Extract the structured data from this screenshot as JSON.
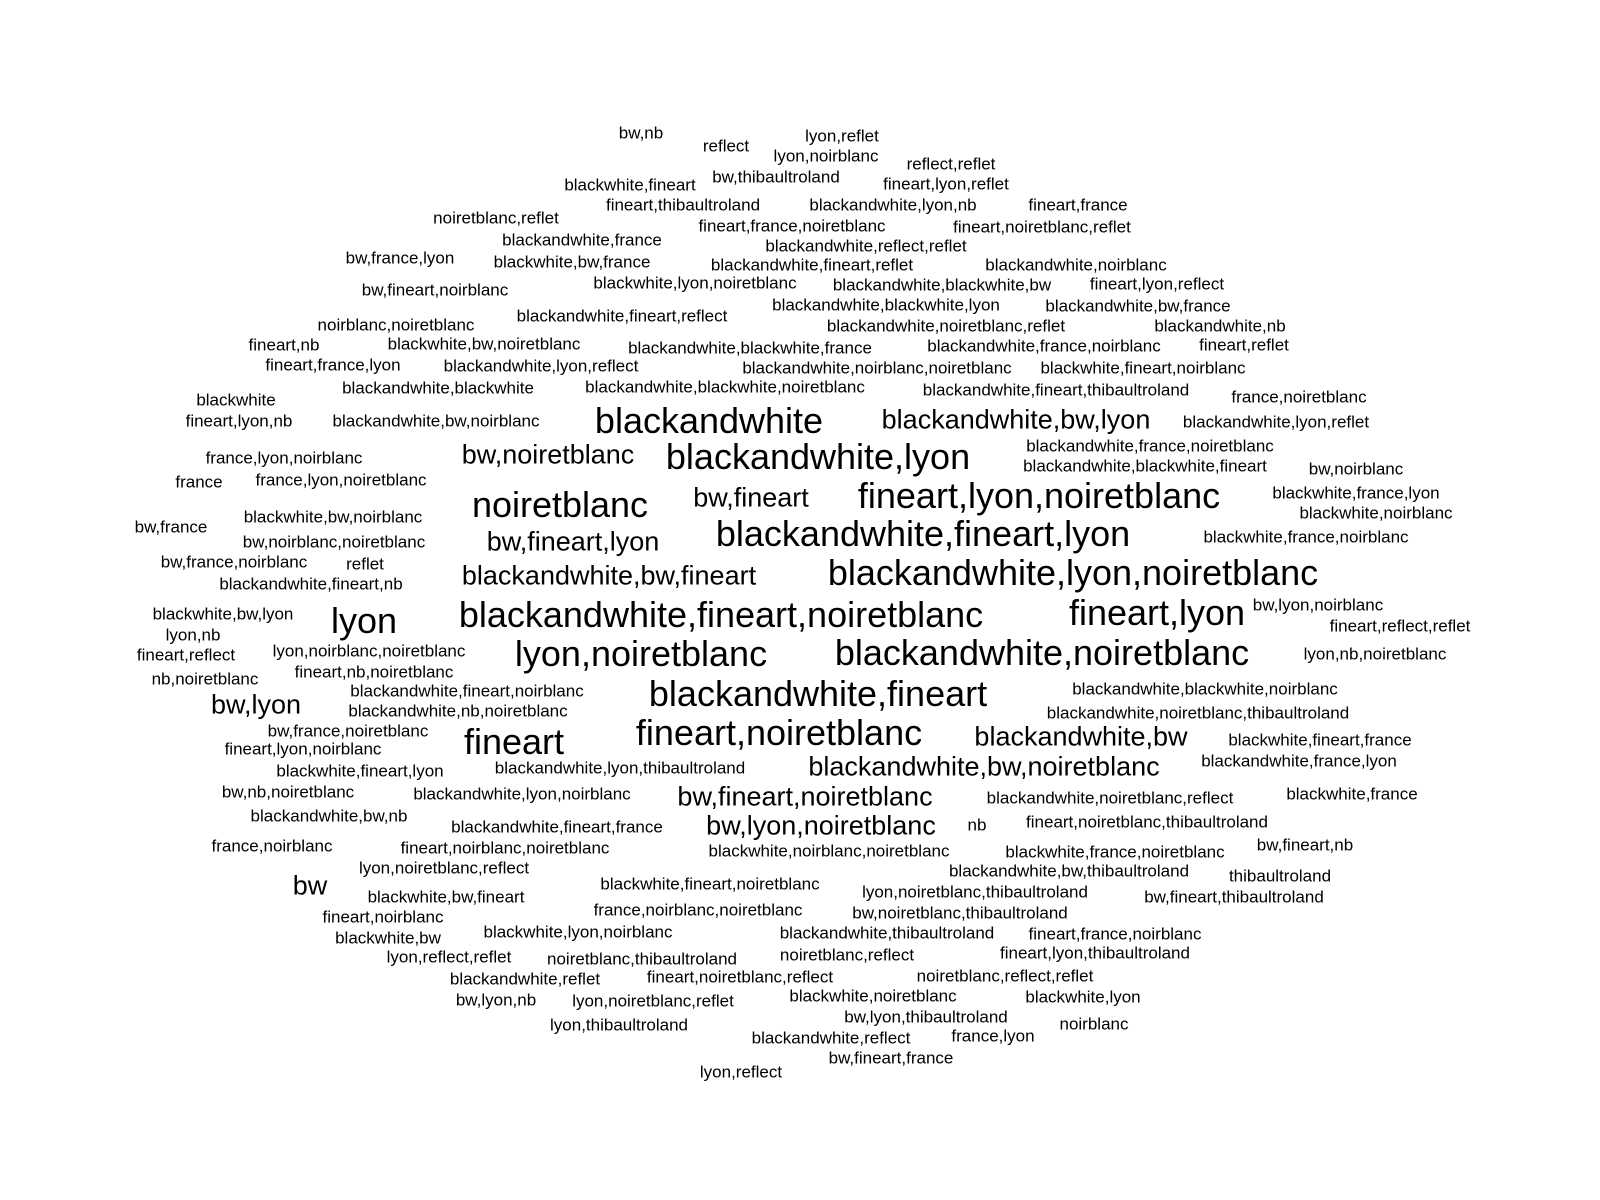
{
  "colors": {
    "background": "#ffffff",
    "text": "#000000"
  },
  "words": [
    "bw,nb",
    "reflect",
    "lyon,reflet",
    "lyon,noirblanc",
    "reflect,reflet",
    "bw,thibaultroland",
    "blackwhite,fineart",
    "fineart,lyon,reflet",
    "fineart,thibaultroland",
    "blackandwhite,lyon,nb",
    "fineart,france",
    "noiretblanc,reflet",
    "fineart,france,noiretblanc",
    "fineart,noiretblanc,reflet",
    "blackandwhite,france",
    "blackandwhite,reflect,reflet",
    "bw,france,lyon",
    "blackwhite,bw,france",
    "blackandwhite,fineart,reflet",
    "blackandwhite,noirblanc",
    "blackwhite,lyon,noiretblanc",
    "blackandwhite,blackwhite,bw",
    "fineart,lyon,reflect",
    "bw,fineart,noirblanc",
    "blackandwhite,blackwhite,lyon",
    "blackandwhite,bw,france",
    "blackandwhite,fineart,reflect",
    "noirblanc,noiretblanc",
    "blackandwhite,noiretblanc,reflet",
    "blackandwhite,nb",
    "fineart,nb",
    "blackwhite,bw,noiretblanc",
    "blackandwhite,blackwhite,france",
    "blackandwhite,france,noirblanc",
    "fineart,reflet",
    "fineart,france,lyon",
    "blackandwhite,lyon,reflect",
    "blackandwhite,noirblanc,noiretblanc",
    "blackwhite,fineart,noirblanc",
    "blackandwhite,blackwhite",
    "blackandwhite,blackwhite,noiretblanc",
    "blackandwhite,fineart,thibaultroland",
    "blackwhite",
    "france,noiretblanc",
    "fineart,lyon,nb",
    "blackandwhite,bw,noirblanc",
    "blackandwhite",
    "blackandwhite,bw,lyon",
    "blackandwhite,lyon,reflet",
    "france,lyon,noirblanc",
    "bw,noiretblanc",
    "blackandwhite,lyon",
    "blackandwhite,france,noiretblanc",
    "blackandwhite,blackwhite,fineart",
    "france",
    "france,lyon,noiretblanc",
    "bw,noirblanc",
    "noiretblanc",
    "bw,fineart",
    "fineart,lyon,noiretblanc",
    "blackwhite,france,lyon",
    "blackwhite,bw,noirblanc",
    "blackwhite,noirblanc",
    "bw,france",
    "bw,fineart,lyon",
    "blackandwhite,fineart,lyon",
    "blackwhite,france,noirblanc",
    "bw,noirblanc,noiretblanc",
    "bw,france,noirblanc",
    "reflet",
    "blackandwhite,bw,fineart",
    "blackandwhite,lyon,noiretblanc",
    "blackandwhite,fineart,nb",
    "bw,lyon,noirblanc",
    "blackwhite,bw,lyon",
    "lyon",
    "blackandwhite,fineart,noiretblanc",
    "fineart,lyon",
    "fineart,reflect,reflet",
    "lyon,nb",
    "fineart,reflect",
    "lyon,noirblanc,noiretblanc",
    "lyon,noiretblanc",
    "blackandwhite,noiretblanc",
    "lyon,nb,noiretblanc",
    "nb,noiretblanc",
    "fineart,nb,noiretblanc",
    "blackandwhite,fineart",
    "blackandwhite,blackwhite,noirblanc",
    "blackandwhite,fineart,noirblanc",
    "bw,lyon",
    "blackandwhite,nb,noiretblanc",
    "blackandwhite,noiretblanc,thibaultroland",
    "bw,france,noiretblanc",
    "fineart",
    "fineart,noiretblanc",
    "blackandwhite,bw",
    "blackwhite,fineart,france",
    "fineart,lyon,noirblanc",
    "blackandwhite,france,lyon",
    "blackwhite,fineart,lyon",
    "blackandwhite,lyon,thibaultroland",
    "blackandwhite,bw,noiretblanc",
    "bw,nb,noiretblanc",
    "blackandwhite,lyon,noirblanc",
    "bw,fineart,noiretblanc",
    "blackandwhite,noiretblanc,reflect",
    "blackwhite,france",
    "blackandwhite,bw,nb",
    "blackandwhite,fineart,france",
    "bw,lyon,noiretblanc",
    "nb",
    "fineart,noiretblanc,thibaultroland",
    "france,noirblanc",
    "fineart,noirblanc,noiretblanc",
    "blackwhite,noirblanc,noiretblanc",
    "blackwhite,france,noiretblanc",
    "bw,fineart,nb",
    "lyon,noiretblanc,reflect",
    "blackandwhite,bw,thibaultroland",
    "bw",
    "thibaultroland",
    "blackwhite,fineart,noiretblanc",
    "lyon,noiretblanc,thibaultroland",
    "blackwhite,bw,fineart",
    "bw,fineart,thibaultroland",
    "france,noirblanc,noiretblanc",
    "bw,noiretblanc,thibaultroland",
    "fineart,noirblanc",
    "blackwhite,bw",
    "blackwhite,lyon,noirblanc",
    "blackandwhite,thibaultroland",
    "fineart,france,noirblanc",
    "lyon,reflect,reflet",
    "noiretblanc,thibaultroland",
    "noiretblanc,reflect",
    "fineart,lyon,thibaultroland",
    "blackandwhite,reflet",
    "fineart,noiretblanc,reflect",
    "noiretblanc,reflect,reflet",
    "bw,lyon,nb",
    "lyon,noiretblanc,reflet",
    "blackwhite,noiretblanc",
    "blackwhite,lyon",
    "bw,lyon,thibaultroland",
    "lyon,thibaultroland",
    "blackandwhite,reflect",
    "france,lyon",
    "noirblanc",
    "bw,fineart,france",
    "lyon,reflect"
  ]
}
